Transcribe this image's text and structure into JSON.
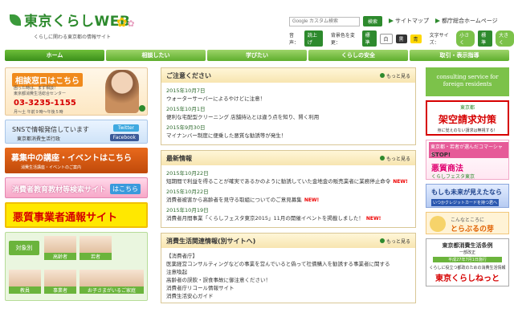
{
  "header": {
    "logo_title": "東京くらしWEB",
    "logo_sub": "くらしに関わる東京都の情報サイト",
    "search_placeholder": "Google カスタム検索",
    "search_button": "検索",
    "sitemap": "サイトマップ",
    "metro_home": "都庁総合ホームページ",
    "voice_label": "音声：",
    "voice_button": "読上げ",
    "bgcolor_label": "背景色を変更：",
    "bg_std": "標準",
    "bg_white": "白",
    "bg_black": "黒",
    "bg_yellow": "青",
    "font_label": "文字サイズ：",
    "font_small": "小さく",
    "font_std": "標準",
    "font_large": "大きく"
  },
  "nav": [
    {
      "label": "ホーム"
    },
    {
      "label": "相談したい"
    },
    {
      "label": "学びたい"
    },
    {
      "label": "くらしの安全"
    },
    {
      "label": "取引・表示指導"
    }
  ],
  "left": {
    "b1_title": "相談窓口はこちら",
    "b1_small1": "困った時は、まず相談！",
    "b1_small2": "東京都消費生活総合センター",
    "b1_phone": "03-3235-1155",
    "b1_hours": "月〜土 午前９時〜午後５時",
    "b2_t1": "SNSで情報発信しています",
    "b2_t2": "東京都消費生活行政",
    "b2_twitter": "Twitter",
    "b2_facebook": "Facebook",
    "b3_t1": "募集中の講座・イベントはこちら",
    "b3_t2": "消費生活講座・イベントのご案内",
    "b4_t1": "消費者教育教材等検索サイト",
    "b4_t2": "はこちら",
    "b5_t1": "悪質事業者通報サイト",
    "b6_label": "対象別",
    "tiles": [
      {
        "caption": "高齢者"
      },
      {
        "caption": "若者"
      },
      {
        "caption": "教員"
      },
      {
        "caption": "事業者"
      },
      {
        "caption": "お子さまがいるご家庭"
      }
    ]
  },
  "notice": {
    "heading": "ご注意ください",
    "more": "もっと見る",
    "items": [
      {
        "date": "2015年10月7日",
        "text": "ウォーターサーバーによるやけどに注意！"
      },
      {
        "date": "2015年10月1日",
        "text": "便利な宅配型クリーニング 店舗持込とは違う点を知り、賢く利用"
      },
      {
        "date": "2015年9月30日",
        "text": "マイナンバー制度に便乗した悪質な勧誘等が発生！"
      }
    ]
  },
  "latest": {
    "heading": "最新情報",
    "more": "もっと見る",
    "new": "NEW!",
    "items": [
      {
        "date": "2015年10月22日",
        "text": "短期間で利益を得ることが確実であるかのように勧誘していた金地金の販売業者に業務停止命令"
      },
      {
        "date": "2015年10月22日",
        "text": "消費者被害から高齢者を見守る取組についてのご意見募集"
      },
      {
        "date": "2015年10月19日",
        "text": "消費者月間事業「くらしフェスタ東京2015」11月の開催イベントを掲載しました！"
      }
    ]
  },
  "related": {
    "heading": "消費生活関連情報(別サイトへ)",
    "more": "もっと見る",
    "tag": "【消費者庁】",
    "lines": [
      "医薬経営コンサルティングなどの事業を営んでいると偽って社債購入を勧誘する事業者に関する",
      "注意喚起",
      "高齢者の誤飲・誤食事故に御注意ください！",
      "消費者庁リコール情報サイト",
      "消費生活安心ガイド"
    ]
  },
  "right": {
    "r1": "consulting service for foreign residents",
    "r2_t1": "東京都",
    "r2_t2": "架空請求対策",
    "r2_t3": "身に覚えのない請求は無視する！",
    "r3_t1": "東京都・若者が選んだコマーシャル",
    "r3_t2": "STOP!",
    "r3_t3": "悪質商法",
    "r3_t4": "くらしフェスタ東京",
    "r4_t1": "もしも未来が見えたなら",
    "r4_t2": "いつかクレジットカードを持つ君へ",
    "r5_t1": "こんなところに",
    "r5_t2": "とらぶるの芽",
    "r6_t1": "東京都消費生活条例",
    "r6_t2": "一部改正",
    "r6_t3": "平成27年7月1日施行",
    "r6_t4": "くらしに役立つ都政のための消費生活情報",
    "r6_t5": "東京くらしねっと"
  },
  "colors": {
    "brand_green": "#2d8a2d",
    "nav_green": "#5fae2e",
    "accent_red": "#d60000"
  }
}
